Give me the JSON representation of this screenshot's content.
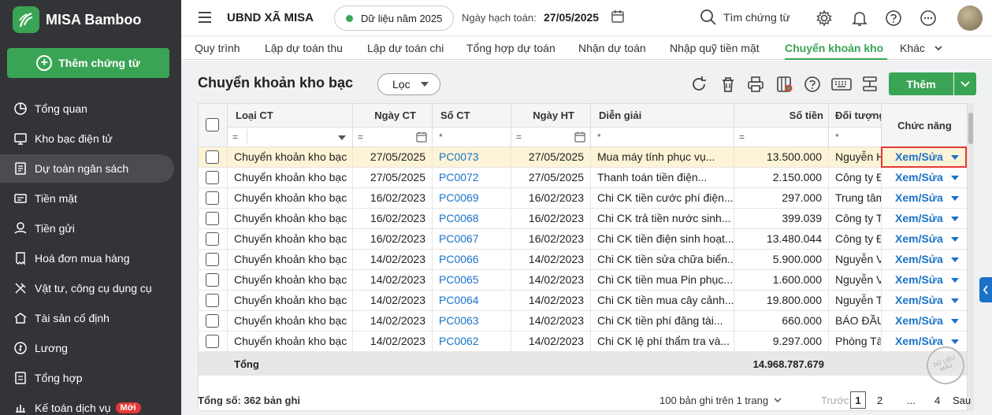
{
  "app": {
    "name": "MISA Bamboo"
  },
  "sidebar": {
    "add_button": "Thêm chứng từ",
    "items": [
      {
        "label": "Tổng quan",
        "icon": "pie-chart-icon"
      },
      {
        "label": "Kho bạc điện tử",
        "icon": "monitor-icon"
      },
      {
        "label": "Dự toán ngân sách",
        "icon": "budget-book-icon",
        "active": true
      },
      {
        "label": "Tiền mặt",
        "icon": "cash-icon"
      },
      {
        "label": "Tiền gửi",
        "icon": "deposit-icon"
      },
      {
        "label": "Hoá đơn mua hàng",
        "icon": "invoice-icon"
      },
      {
        "label": "Vật tư, công cụ dụng cụ",
        "icon": "tools-icon"
      },
      {
        "label": "Tài sản cố định",
        "icon": "building-icon"
      },
      {
        "label": "Lương",
        "icon": "salary-icon"
      },
      {
        "label": "Tổng hợp",
        "icon": "summary-icon"
      },
      {
        "label": "Kế toán dịch vụ",
        "icon": "service-icon",
        "badge": "Mới"
      }
    ]
  },
  "topbar": {
    "org": "UBND XÃ MISA",
    "data_year": "Dữ liệu năm 2025",
    "posting_date_label": "Ngày hạch toán:",
    "posting_date": "27/05/2025",
    "search_label": "Tìm chứng từ"
  },
  "tabs": [
    "Quy trình",
    "Lập dự toán thu",
    "Lập dự toán chi",
    "Tổng hợp dự toán",
    "Nhận dự toán",
    "Nhập quỹ tiền mặt",
    "Chuyển khoản kho bạc",
    "Khác"
  ],
  "active_tab_index": 6,
  "page": {
    "title": "Chuyển khoản kho bạc",
    "filter_label": "Lọc",
    "add_label": "Thêm"
  },
  "table": {
    "columns": [
      "Loại CT",
      "Ngày CT",
      "Số CT",
      "Ngày HT",
      "Diễn giải",
      "Số tiền",
      "Đối tượng",
      "Chức năng"
    ],
    "filters": {
      "type_op": "=",
      "date_op": "=",
      "no_op": "*",
      "ht_op": "=",
      "desc_op": "*",
      "amount_op": "=",
      "obj_op": "*"
    },
    "rows": [
      {
        "type": "Chuyển khoản kho bạc",
        "date": "27/05/2025",
        "no": "PC0073",
        "ht": "27/05/2025",
        "desc": "Mua máy tính phục vụ...",
        "amount": "13.500.000",
        "obj": "Nguyễn H",
        "action": "Xem/Sửa"
      },
      {
        "type": "Chuyển khoản kho bạc",
        "date": "27/05/2025",
        "no": "PC0072",
        "ht": "27/05/2025",
        "desc": "Thanh toán tiền điện...",
        "amount": "2.150.000",
        "obj": "Công ty Đ",
        "action": "Xem/Sửa"
      },
      {
        "type": "Chuyển khoản kho bạc",
        "date": "16/02/2023",
        "no": "PC0069",
        "ht": "16/02/2023",
        "desc": "Chi CK tiền cước phí điện...",
        "amount": "297.000",
        "obj": "Trung tâm",
        "action": "Xem/Sửa"
      },
      {
        "type": "Chuyển khoản kho bạc",
        "date": "16/02/2023",
        "no": "PC0068",
        "ht": "16/02/2023",
        "desc": "Chi CK trả tiền nước sinh...",
        "amount": "399.039",
        "obj": "Công ty T",
        "action": "Xem/Sửa"
      },
      {
        "type": "Chuyển khoản kho bạc",
        "date": "16/02/2023",
        "no": "PC0067",
        "ht": "16/02/2023",
        "desc": "Chi CK tiền điện sinh hoạt...",
        "amount": "13.480.044",
        "obj": "Công ty Đ",
        "action": "Xem/Sửa"
      },
      {
        "type": "Chuyển khoản kho bạc",
        "date": "14/02/2023",
        "no": "PC0066",
        "ht": "14/02/2023",
        "desc": "Chi CK tiền sửa chữa biển...",
        "amount": "5.900.000",
        "obj": "Nguyễn V",
        "action": "Xem/Sửa"
      },
      {
        "type": "Chuyển khoản kho bạc",
        "date": "14/02/2023",
        "no": "PC0065",
        "ht": "14/02/2023",
        "desc": "Chi CK tiền mua Pin phục...",
        "amount": "1.600.000",
        "obj": "Nguyễn V",
        "action": "Xem/Sửa"
      },
      {
        "type": "Chuyển khoản kho bạc",
        "date": "14/02/2023",
        "no": "PC0064",
        "ht": "14/02/2023",
        "desc": "Chi CK tiền mua cây cảnh...",
        "amount": "19.800.000",
        "obj": "Nguyễn T",
        "action": "Xem/Sửa"
      },
      {
        "type": "Chuyển khoản kho bạc",
        "date": "14/02/2023",
        "no": "PC0063",
        "ht": "14/02/2023",
        "desc": "Chi CK tiền phí đăng tài...",
        "amount": "660.000",
        "obj": "BÁO ĐẦU",
        "action": "Xem/Sửa"
      },
      {
        "type": "Chuyển khoản kho bạc",
        "date": "14/02/2023",
        "no": "PC0062",
        "ht": "14/02/2023",
        "desc": "Chi CK lệ phí thẩm tra và...",
        "amount": "9.297.000",
        "obj": "Phòng Tài",
        "action": "Xem/Sửa"
      }
    ],
    "total_label": "Tổng",
    "total_amount": "14.968.787.679"
  },
  "footer": {
    "total_records": "Tổng số: 362 bản ghi",
    "page_size": "100 bản ghi trên 1 trang",
    "prev": "Trước",
    "pages": [
      "1",
      "2",
      "...",
      "4"
    ],
    "next": "Sau"
  },
  "watermark": "DỮ LIỆU MẪU",
  "colors": {
    "accent": "#3aa455",
    "link": "#1a73c8",
    "sidebar": "#333438",
    "highlight": "#e53935",
    "selected_row": "#fdf3d6"
  }
}
